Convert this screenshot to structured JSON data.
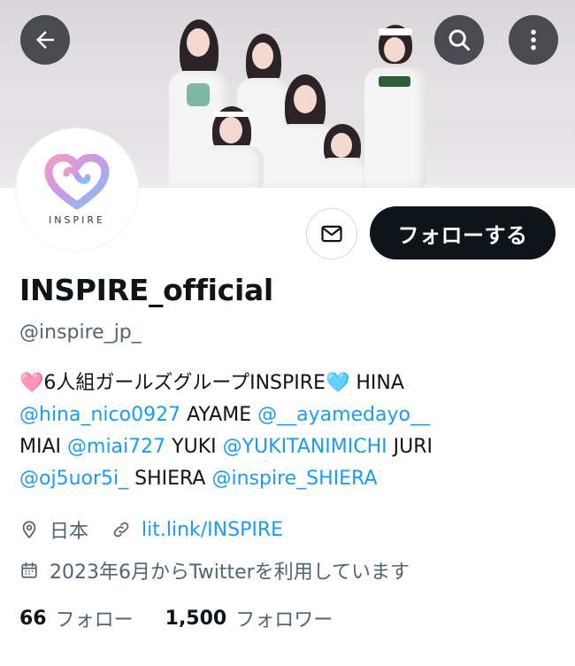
{
  "header": {
    "back_icon": "arrow-left-icon",
    "search_icon": "search-icon",
    "more_icon": "more-vertical-icon"
  },
  "avatar": {
    "logo_text": "INSPIRE"
  },
  "actions": {
    "message_icon": "envelope-icon",
    "follow_label": "フォローする"
  },
  "profile": {
    "display_name": "INSPIRE_official",
    "handle": "@inspire_jp_"
  },
  "bio": {
    "line1": {
      "heart_pink": "🩷",
      "text1": "6人組ガールズグループINSPIRE",
      "heart_blue": "🩵",
      "text2": " HINA"
    },
    "line2": {
      "link1": "@hina_nico0927",
      "text1": " AYAME ",
      "link2": "@__ayamedayo__"
    },
    "line3": {
      "text1": "MIAI ",
      "link1": "@miai727",
      "text2": " YUKI ",
      "link2": "@YUKITANIMICHI",
      "text3": " JURI"
    },
    "line4": {
      "link1": "@oj5uor5i_",
      "text1": " SHIERA ",
      "link2": "@inspire_SHIERA"
    }
  },
  "meta": {
    "location": "日本",
    "location_icon": "location-pin-icon",
    "link": "lit.link/INSPIRE",
    "link_icon": "link-icon",
    "joined": "2023年6月からTwitterを利用しています",
    "joined_icon": "calendar-icon"
  },
  "stats": {
    "following_count": "66",
    "following_label": "フォロー",
    "followers_count": "1,500",
    "followers_label": "フォロワー"
  },
  "colors": {
    "link": "#1d9bf0",
    "secondary_text": "#536471",
    "primary_text": "#0f1419",
    "follow_button_bg": "#0f1419"
  }
}
